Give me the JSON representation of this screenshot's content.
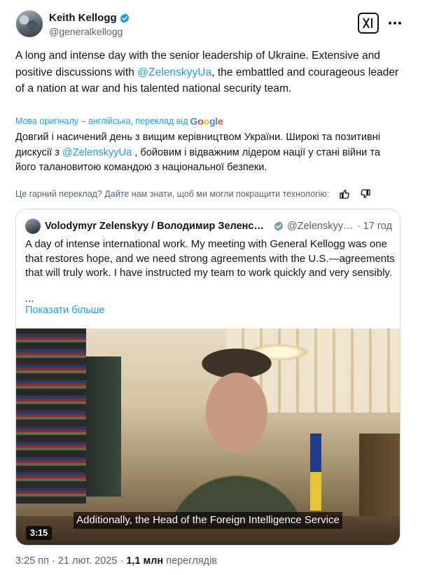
{
  "author": {
    "display_name": "Keith Kellogg",
    "handle": "@generalkellogg"
  },
  "tweet": {
    "text_before": "A long and intense day with the senior leadership of Ukraine.  Extensive and positive discussions with ",
    "mention": "@ZelenskyyUa",
    "text_after": ", the embattled and courageous leader of a nation at war and his talented national security team."
  },
  "translation": {
    "note": "Мова оригіналу – англійська, переклад від",
    "provider": "Google",
    "text_before": "Довгий і насичений день з вищим керівництвом України. Широкі та позитивні дискусії з ",
    "mention": "@ZelenskyyUa",
    "text_after": " , бойовим і відважним лідером нації у стані війни та його талановитою командою з національної безпеки.",
    "feedback": "Це гарний переклад? Дайте нам знати, щоб ми могли покращити технологію:"
  },
  "quote": {
    "display_name": "Volodymyr Zelenskyy / Володимир Зеленський",
    "handle": "@ZelenskyyUa",
    "separator": "·",
    "time": "17 год",
    "text": "A day of intense international work. My meeting with General Kellogg was one that restores hope, and we need strong agreements with the U.S.—agreements that will truly work. I have instructed my team to work quickly and very sensibly.",
    "ellipsis": "...",
    "show_more": "Показати більше",
    "video": {
      "caption": "Additionally, the Head of the Foreign Intelligence Service",
      "duration": "3:15"
    }
  },
  "meta": {
    "time": "3:25 пп",
    "separator1": "·",
    "date": "21 лют. 2025",
    "separator2": "·",
    "views_count": "1,1 млн",
    "views_label": "переглядів"
  },
  "colors": {
    "link": "#1d9bf0",
    "verified": "#1d9bf0",
    "secondary_text": "#536471"
  },
  "icons": [
    "verified-icon",
    "grok-icon",
    "more-icon",
    "thumbs-up-icon",
    "thumbs-down-icon"
  ]
}
